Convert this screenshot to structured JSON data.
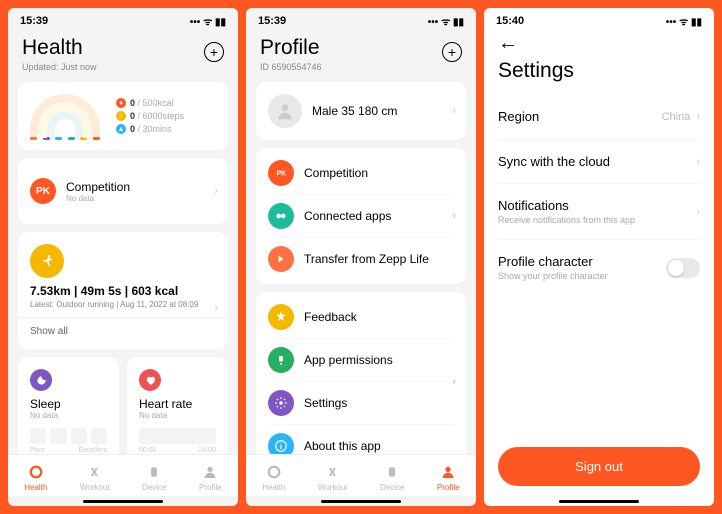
{
  "health": {
    "time": "15:39",
    "title": "Health",
    "updated": "Updated: Just now",
    "cal_cur": "0",
    "cal_goal": "500",
    "cal_unit": "kcal",
    "steps_cur": "0",
    "steps_goal": "6000",
    "steps_unit": "steps",
    "stand_cur": "0",
    "stand_goal": "30",
    "stand_unit": "mins",
    "competition": "Competition",
    "no_data": "No data",
    "workout_stats": "7.53km | 49m 5s | 603 kcal",
    "workout_sub": "Latest: Outdoor running | Aug 11, 2022 at 08:09",
    "show_all": "Show all",
    "sleep": "Sleep",
    "heart": "Heart rate",
    "scale_poor": "Poor",
    "scale_exc": "Excellent",
    "scale_0": "00:00",
    "scale_24": "24:00"
  },
  "profile": {
    "time": "15:39",
    "title": "Profile",
    "id": "ID 6590554746",
    "user_info": "Male 35 180 cm",
    "items1": [
      "Competition",
      "Connected apps",
      "Transfer from Zepp Life"
    ],
    "items2": [
      "Feedback",
      "App permissions",
      "Settings",
      "About this app"
    ]
  },
  "colors": {
    "icon1": [
      "#ff5722",
      "#1abc9c",
      "#ff7043"
    ],
    "icon2": [
      "#f5b800",
      "#27ae60",
      "#7e57c2",
      "#29b6f6"
    ]
  },
  "settings": {
    "time": "15:40",
    "title": "Settings",
    "region": "Region",
    "region_val": "China",
    "sync": "Sync with the cloud",
    "notif": "Notifications",
    "notif_sub": "Receive notifications from this app",
    "char": "Profile character",
    "char_sub": "Show your profile character",
    "signout": "Sign out"
  },
  "tabs": [
    "Health",
    "Workout",
    "Device",
    "Profile"
  ]
}
